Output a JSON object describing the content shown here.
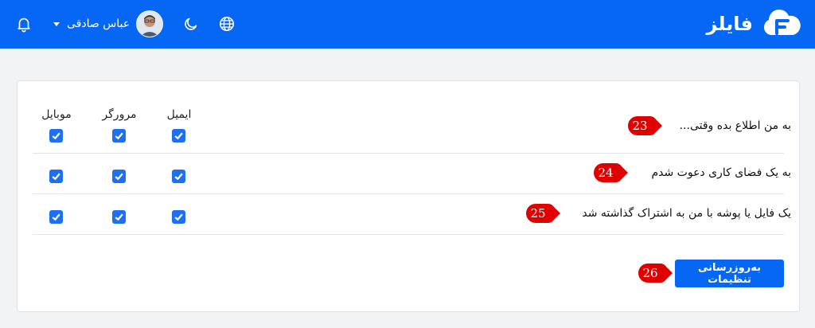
{
  "app": {
    "brand": "فایلز"
  },
  "header": {
    "username": "عباس صادقی",
    "icons": [
      "bell-icon",
      "chevron-down-icon",
      "moon-icon",
      "globe-icon",
      "cloud-logo"
    ]
  },
  "notifications": {
    "columns": [
      "ایمیل",
      "مرورگر",
      "موبایل"
    ],
    "rows": [
      {
        "title": "به من اطلاع بده وقتی...",
        "email": true,
        "browser": true,
        "mobile": true
      },
      {
        "title": "به یک فضای کاری دعوت شدم",
        "email": true,
        "browser": true,
        "mobile": true
      },
      {
        "title": "یک فایل یا پوشه با من به اشتراک گذاشته شد",
        "email": true,
        "browser": true,
        "mobile": true
      }
    ],
    "update_button": "به‌روزرسانی تنظیمات"
  },
  "markers": [
    "23",
    "24",
    "25",
    "26"
  ],
  "colors": {
    "primary": "#0767f5",
    "marker": "#e00000",
    "background": "#f2f3f5"
  }
}
